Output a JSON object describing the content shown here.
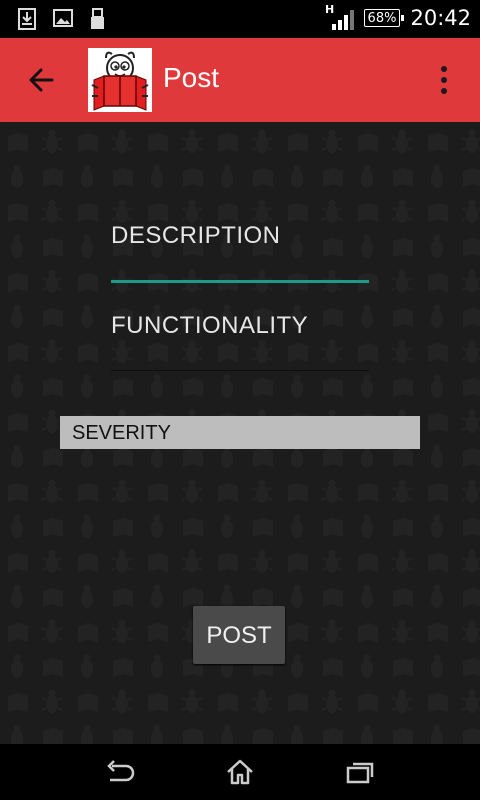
{
  "status_bar": {
    "time": "20:42",
    "battery": "68%",
    "network_type": "H",
    "icons": [
      "download-notification-icon",
      "image-notification-icon",
      "usb-icon",
      "signal-icon",
      "battery-icon"
    ]
  },
  "app_bar": {
    "title": "Post",
    "back_icon": "arrow-left-icon",
    "logo": "bug-reading-book-logo",
    "overflow_icon": "more-vert-icon",
    "background_color": "#e0393b"
  },
  "form": {
    "description_hint": "DESCRIPTION",
    "functionality_hint": "FUNCTIONALITY",
    "severity_selected": "SEVERITY",
    "post_label": "POST",
    "focus_underline_color": "#1e9a8a"
  },
  "nav_bar": {
    "icons": [
      "back-nav-icon",
      "home-icon",
      "recent-apps-icon"
    ]
  }
}
